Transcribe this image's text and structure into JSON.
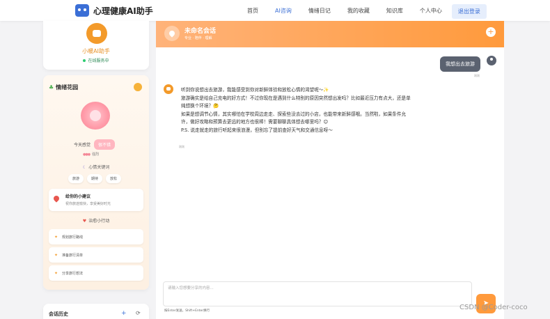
{
  "navbar": {
    "brand": "心理健康AI助手",
    "items": [
      "首页",
      "AI咨询",
      "情绪日记",
      "我的收藏",
      "知识库",
      "个人中心"
    ],
    "login": "退出登录"
  },
  "assistant": {
    "name": "小暖AI助手",
    "status": "在线服务中"
  },
  "mood": {
    "title": "情绪花园",
    "today_label": "今天感觉",
    "today_value": "很不错",
    "intensity": "强烈",
    "keywords_title": "心情关键词",
    "keywords": [
      "旅游",
      "期待",
      "放松"
    ],
    "tip_title": "给你的小建议",
    "tip_text": "祝你旅途愉快，享受美好时光",
    "actions_title": "治愈小行动",
    "actions": [
      "规划旅行路线",
      "准备旅行清单",
      "分享旅行想法"
    ]
  },
  "history": {
    "title": "会话历史",
    "add": "+",
    "refresh": "⟳"
  },
  "chat": {
    "title": "未命名会话",
    "subtitle": "专业 · 陪伴 · 理解",
    "user_message": "我想出去旅游",
    "user_time": "刚刚",
    "bot_time": "刚刚",
    "bot_lines": [
      "听到你说想出去旅游，我能感受到你对新鲜体验和放松心情的渴望呢～✨",
      "旅游确实是给自己充电的好方式！不过你现在是遇到什么特别的原因突然想出发吗？比如最近压力有点大，还是单纯想换个环境？🤔",
      "如果是想调节心情，其实哪怕在学校周边走走、探索些没去过的小店，也能带来新鲜感哦。当然啦，如果条件允许，做好攻略和预算去更远的地方也很棒！需要聊聊具体想去哪里吗？😊",
      "P.S. 说走就走的旅行听起来很浪漫，但别忘了提前查好天气和交通信息呀～"
    ],
    "input_placeholder": "请输入您想要分享的内容...",
    "input_hint": "按Enter发送，Shift+Enter换行",
    "send": "➤"
  },
  "watermark": "CSDN @Coder-coco"
}
